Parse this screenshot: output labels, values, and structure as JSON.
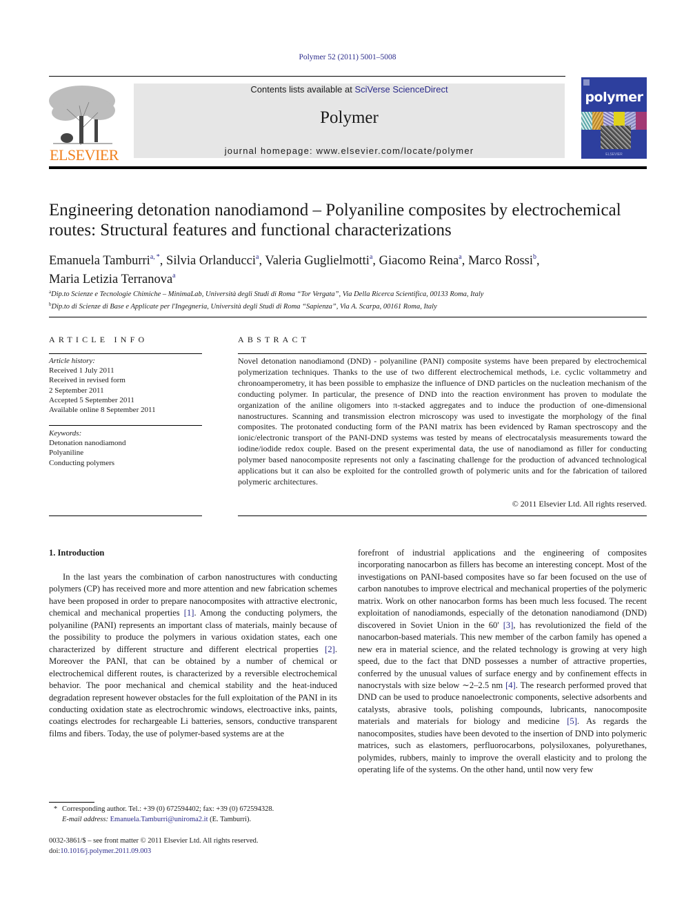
{
  "citation": "Polymer 52 (2011) 5001–5008",
  "masthead": {
    "publisher_logo_text": "ELSEVIER",
    "contents_prefix": "Contents lists available at ",
    "contents_link": "SciVerse ScienceDirect",
    "journal_name": "Polymer",
    "homepage": "journal homepage: www.elsevier.com/locate/polymer",
    "cover_title": "polymer",
    "colors": {
      "elsevier_orange": "#f07f1b",
      "banner_gray": "#e6e6e6",
      "cover_blue": "#2d3f9e",
      "link_blue": "#2a2a8a"
    }
  },
  "article": {
    "title": "Engineering detonation nanodiamond – Polyaniline composites by electrochemical routes: Structural features and functional characterizations",
    "authors": [
      {
        "name": "Emanuela Tamburri",
        "sup": "a, *",
        "sep": ", "
      },
      {
        "name": "Silvia Orlanducci",
        "sup": "a",
        "sep": ", "
      },
      {
        "name": "Valeria Guglielmotti",
        "sup": "a",
        "sep": ", "
      },
      {
        "name": "Giacomo Reina",
        "sup": "a",
        "sep": ", "
      },
      {
        "name": "Marco Rossi",
        "sup": "b",
        "sep": ","
      },
      {
        "name": "Maria Letizia Terranova",
        "sup": "a",
        "sep": ""
      }
    ],
    "affiliations": [
      {
        "key": "a",
        "text": "Dip.to Scienze e Tecnologie Chimiche – MinimaLab, Università degli Studi di Roma “Tor Vergata”, Via Della Ricerca Scientifica, 00133 Roma, Italy"
      },
      {
        "key": "b",
        "text": "Dip.to di Scienze di Base e Applicate per l'Ingegneria, Università degli Studi di Roma “Sapienza”, Via A. Scarpa, 00161 Roma, Italy"
      }
    ]
  },
  "article_info": {
    "heading": "ARTICLE INFO",
    "history_label": "Article history:",
    "history": [
      "Received 1 July 2011",
      "Received in revised form",
      "2 September 2011",
      "Accepted 5 September 2011",
      "Available online 8 September 2011"
    ],
    "keywords_label": "Keywords:",
    "keywords": [
      "Detonation nanodiamond",
      "Polyaniline",
      "Conducting polymers"
    ]
  },
  "abstract": {
    "heading": "ABSTRACT",
    "text": "Novel detonation nanodiamond (DND) - polyaniline (PANI) composite systems have been prepared by electrochemical polymerization techniques. Thanks to the use of two different electrochemical methods, i.e. cyclic voltammetry and chronoamperometry, it has been possible to emphasize the influence of DND particles on the nucleation mechanism of the conducting polymer. In particular, the presence of DND into the reaction environment has proven to modulate the organization of the aniline oligomers into π-stacked aggregates and to induce the production of one-dimensional nanostructures. Scanning and transmission electron microscopy was used to investigate the morphology of the final composites. The protonated conducting form of the PANI matrix has been evidenced by Raman spectroscopy and the ionic/electronic transport of the PANI-DND systems was tested by means of electrocatalysis measurements toward the iodine/iodide redox couple. Based on the present experimental data, the use of nanodiamond as filler for conducting polymer based nanocomposite represents not only a fascinating challenge for the production of advanced technological applications but it can also be exploited for the controlled growth of polymeric units and for the fabrication of tailored polymeric architectures.",
    "copyright": "© 2011 Elsevier Ltd. All rights reserved."
  },
  "introduction": {
    "heading": "1.  Introduction",
    "left_parts": [
      {
        "t": "In the last years the combination of carbon nanostructures with conducting polymers (CP) has received more and more attention and new fabrication schemes have been proposed in order to prepare nanocomposites with attractive electronic, chemical and mechanical properties "
      },
      {
        "ref": "[1]"
      },
      {
        "t": ". Among the conducting polymers, the polyaniline (PANI) represents an important class of materials, mainly because of the possibility to produce the polymers in various oxidation states, each one characterized by different structure and different electrical properties "
      },
      {
        "ref": "[2]"
      },
      {
        "t": ". Moreover the PANI, that can be obtained by a number of chemical or electrochemical different routes, is characterized by a reversible electrochemical behavior. The poor mechanical and chemical stability and the heat-induced degradation represent however obstacles for the full exploitation of the PANI in its conducting oxidation state as electrochromic windows, electroactive inks, paints, coatings electrodes for rechargeable Li batteries, sensors, conductive transparent films and fibers. Today, the use of polymer-based systems are at the"
      }
    ],
    "right_parts": [
      {
        "t": "forefront of industrial applications and the engineering of composites incorporating nanocarbon as fillers has become an interesting concept. Most of the investigations on PANI-based composites have so far been focused on the use of carbon nanotubes to improve electrical and mechanical properties of the polymeric matrix. Work on other nanocarbon forms has been much less focused. The recent exploitation of nanodiamonds, especially of the detonation nanodiamond (DND) discovered in Soviet Union in the 60' "
      },
      {
        "ref": "[3]"
      },
      {
        "t": ", has revolutionized the field of the nanocarbon-based materials. This new member of the carbon family has opened a new era in material science, and the related technology is growing at very high speed, due to the fact that DND possesses a number of attractive properties, conferred by the unusual values of surface energy and by confinement effects in nanocrystals with size below ∼2–2.5 nm "
      },
      {
        "ref": "[4]"
      },
      {
        "t": ". The research performed proved that DND can be used to produce nanoelectronic components, selective adsorbents and catalysts, abrasive tools, polishing compounds, lubricants, nanocomposite materials and materials for biology and medicine "
      },
      {
        "ref": "[5]"
      },
      {
        "t": ". As regards the nanocomposites, studies have been devoted to the insertion of DND into polymeric matrices, such as elastomers, perfluorocarbons, polysiloxanes, polyurethanes, polymides, rubbers, mainly to improve the overall elasticity and to prolong the operating life of the systems. On the other hand, until now very few"
      }
    ]
  },
  "footnote": {
    "marker": "*",
    "corresponding": "Corresponding author. Tel.: +39 (0) 672594402; fax: +39 (0) 672594328.",
    "email_label": "E-mail address:",
    "email": "Emanuela.Tamburri@uniroma2.it",
    "email_suffix": " (E. Tamburri)."
  },
  "front_matter": {
    "issn_line": "0032-3861/$ – see front matter © 2011 Elsevier Ltd. All rights reserved.",
    "doi_label": "doi:",
    "doi": "10.1016/j.polymer.2011.09.003"
  }
}
